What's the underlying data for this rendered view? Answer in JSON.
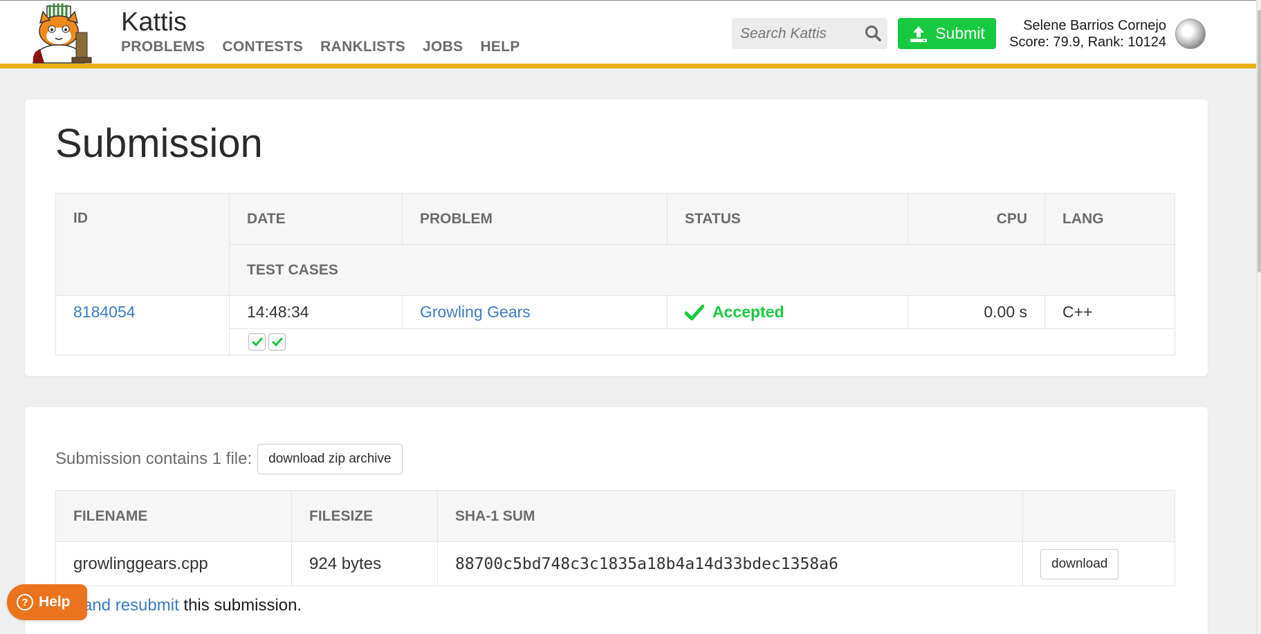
{
  "header": {
    "brand": "Kattis",
    "nav": [
      "PROBLEMS",
      "CONTESTS",
      "RANKLISTS",
      "JOBS",
      "HELP"
    ],
    "search_placeholder": "Search Kattis",
    "submit_label": "Submit",
    "user_name": "Selene Barrios Cornejo",
    "user_score": "Score: 79.9, Rank: 10124"
  },
  "submission": {
    "title": "Submission",
    "columns": {
      "id": "ID",
      "date": "DATE",
      "problem": "PROBLEM",
      "status": "STATUS",
      "cpu": "CPU",
      "lang": "LANG",
      "test_cases": "TEST CASES"
    },
    "row": {
      "id": "8184054",
      "date": "14:48:34",
      "problem": "Growling Gears",
      "status": "Accepted",
      "cpu": "0.00 s",
      "lang": "C++",
      "test_case_count": 2
    }
  },
  "files": {
    "heading": "Submission contains 1 file:",
    "download_zip_label": "download zip archive",
    "columns": {
      "filename": "FILENAME",
      "filesize": "FILESIZE",
      "sha1": "SHA-1 SUM"
    },
    "rows": [
      {
        "filename": "growlinggears.cpp",
        "filesize": "924 bytes",
        "sha1": "88700c5bd748c3c1835a18b4a14d33bdec1358a6",
        "download_label": "download"
      }
    ],
    "resubmit_link": "and resubmit",
    "resubmit_rest": " this submission."
  },
  "help_widget": {
    "label": "Help"
  },
  "colors": {
    "accent_bar": "#e8b10e",
    "submit_green": "#17c941",
    "link_blue": "#3b7bc6",
    "help_orange": "#e9741d"
  }
}
